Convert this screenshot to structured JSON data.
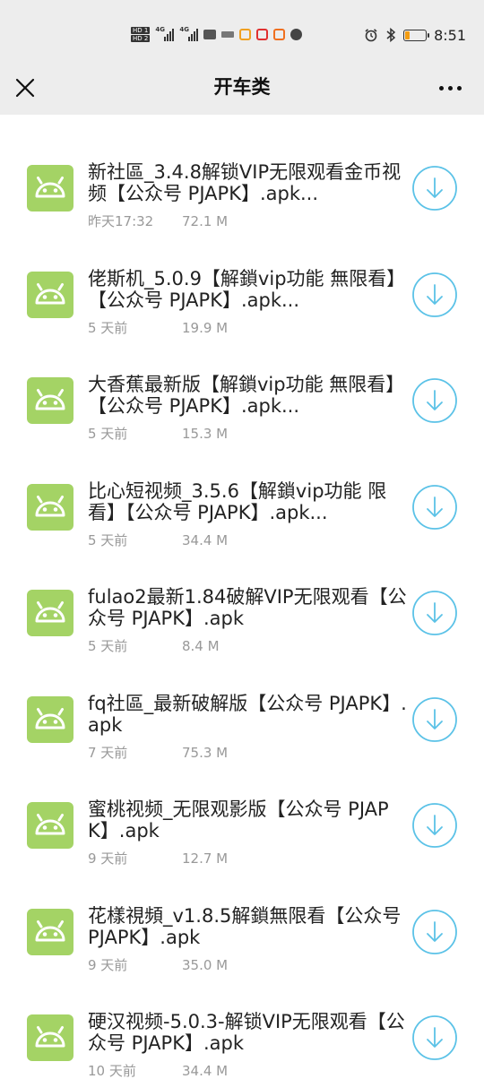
{
  "status_bar": {
    "hd1": "HD 1",
    "hd2": "HD 2",
    "net1": "4G",
    "net2": "4G",
    "time": "8:51",
    "battery_level": 0.2
  },
  "nav": {
    "title": "开车类"
  },
  "colors": {
    "thumb_bg": "#a4d365",
    "download_accent": "#5bc2e7",
    "meta_text": "#999999"
  },
  "files": [
    {
      "name": "新社區_3.4.8解锁VIP无限观看金币视频【公众号 PJAPK】.apk...",
      "time": "昨天17:32",
      "size": "72.1 M",
      "icon": "android-icon"
    },
    {
      "name": "佬斯机_5.0.9【解鎖vip功能 無限看】【公众号 PJAPK】.apk...",
      "time": "5 天前",
      "size": "19.9 M",
      "icon": "android-icon"
    },
    {
      "name": "大香蕉最新版【解鎖vip功能 無限看】【公众号 PJAPK】.apk...",
      "time": "5 天前",
      "size": "15.3 M",
      "icon": "android-icon"
    },
    {
      "name": "比心短视频_3.5.6【解鎖vip功能 限看】【公众号 PJAPK】.apk...",
      "time": "5 天前",
      "size": "34.4 M",
      "icon": "android-icon"
    },
    {
      "name": "fulao2最新1.84破解VIP无限观看【公众号 PJAPK】.apk",
      "time": "5 天前",
      "size": "8.4 M",
      "icon": "android-icon"
    },
    {
      "name": "fq社區_最新破解版【公众号 PJAPK】.apk",
      "time": "7 天前",
      "size": "75.3 M",
      "icon": "android-icon"
    },
    {
      "name": "蜜桃视频_无限观影版【公众号 PJAPK】.apk",
      "time": "9 天前",
      "size": "12.7 M",
      "icon": "android-icon"
    },
    {
      "name": "花樣視頻_v1.8.5解鎖無限看【公众号 PJAPK】.apk",
      "time": "9 天前",
      "size": "35.0 M",
      "icon": "android-icon"
    },
    {
      "name": "硬汉视频-5.0.3-解锁VIP无限观看【公众号 PJAPK】.apk",
      "time": "10 天前",
      "size": "34.4 M",
      "icon": "android-icon"
    }
  ]
}
